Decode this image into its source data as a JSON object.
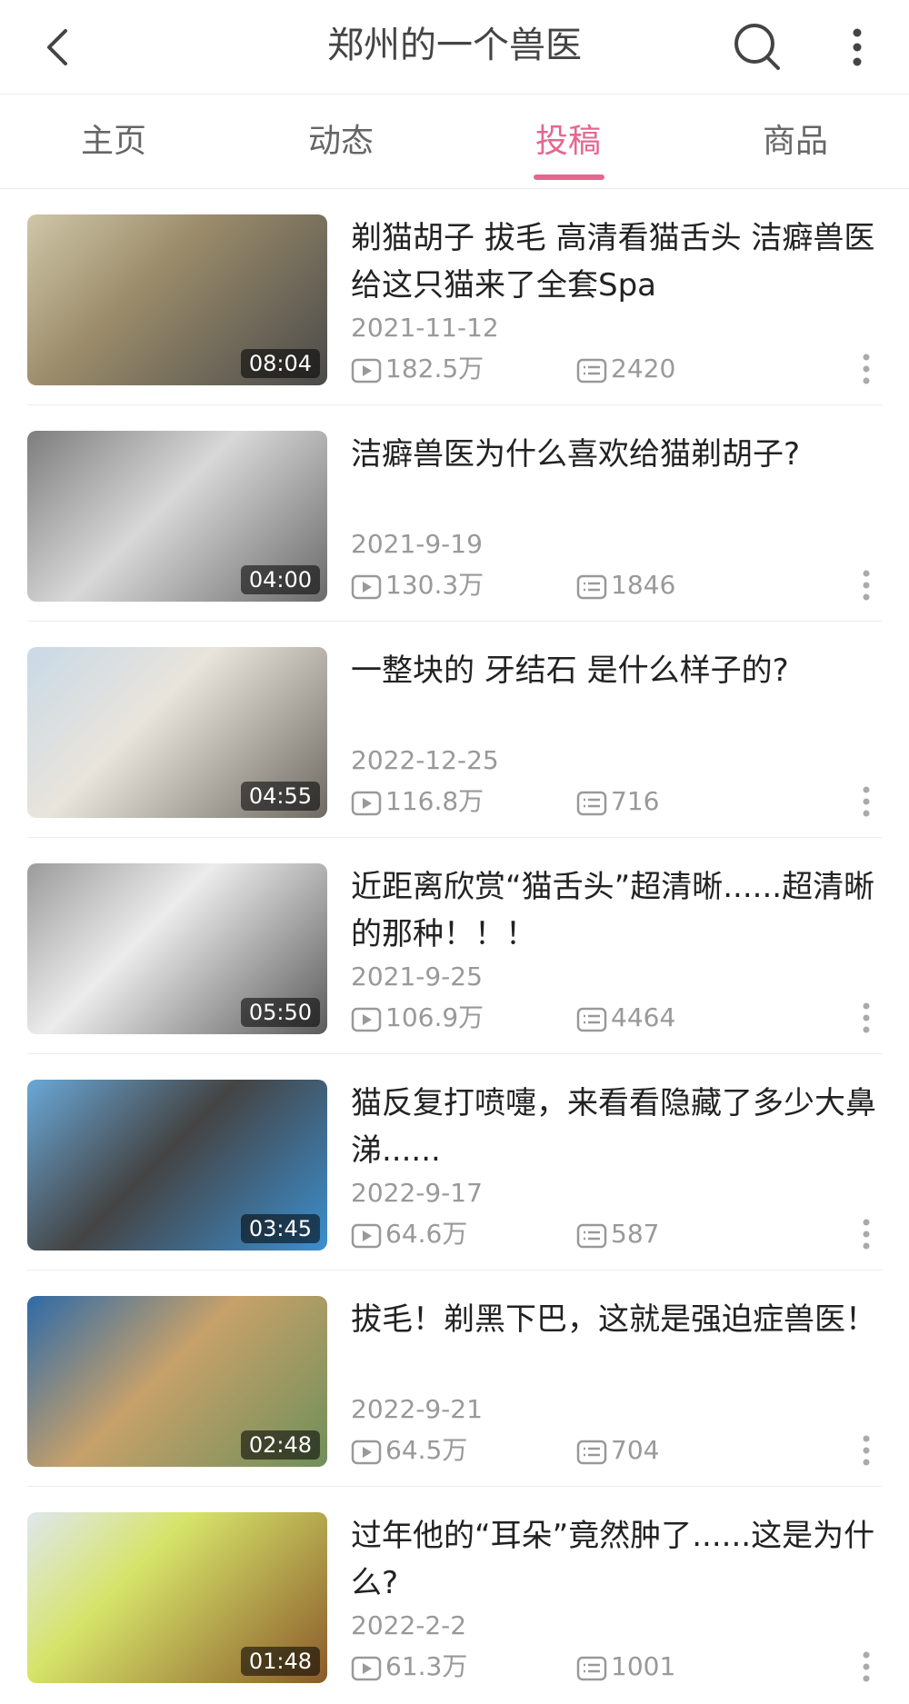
{
  "header": {
    "title": "郑州的一个兽医"
  },
  "tabs": [
    {
      "label": "主页",
      "active": false
    },
    {
      "label": "动态",
      "active": false
    },
    {
      "label": "投稿",
      "active": true
    },
    {
      "label": "商品",
      "active": false
    }
  ],
  "accent_color": "#e5678f",
  "videos": [
    {
      "title": "剃猫胡子  拔毛  高清看猫舌头  洁癖兽医给这只猫来了全套Spa",
      "date": "2021-11-12",
      "views": "182.5万",
      "comments": "2420",
      "duration": "08:04"
    },
    {
      "title": "洁癖兽医为什么喜欢给猫剃胡子?",
      "date": "2021-9-19",
      "views": "130.3万",
      "comments": "1846",
      "duration": "04:00"
    },
    {
      "title": "一整块的  牙结石  是什么样子的?",
      "date": "2022-12-25",
      "views": "116.8万",
      "comments": "716",
      "duration": "04:55"
    },
    {
      "title": "近距离欣赏“猫舌头”超清晰......超清晰的那种！！！",
      "date": "2021-9-25",
      "views": "106.9万",
      "comments": "4464",
      "duration": "05:50"
    },
    {
      "title": "猫反复打喷嚏，来看看隐藏了多少大鼻涕......",
      "date": "2022-9-17",
      "views": "64.6万",
      "comments": "587",
      "duration": "03:45"
    },
    {
      "title": "拔毛！剃黑下巴，这就是强迫症兽医！",
      "date": "2022-9-21",
      "views": "64.5万",
      "comments": "704",
      "duration": "02:48"
    },
    {
      "title": "过年他的“耳朵”竟然肿了......这是为什么?",
      "date": "2022-2-2",
      "views": "61.3万",
      "comments": "1001",
      "duration": "01:48"
    }
  ]
}
